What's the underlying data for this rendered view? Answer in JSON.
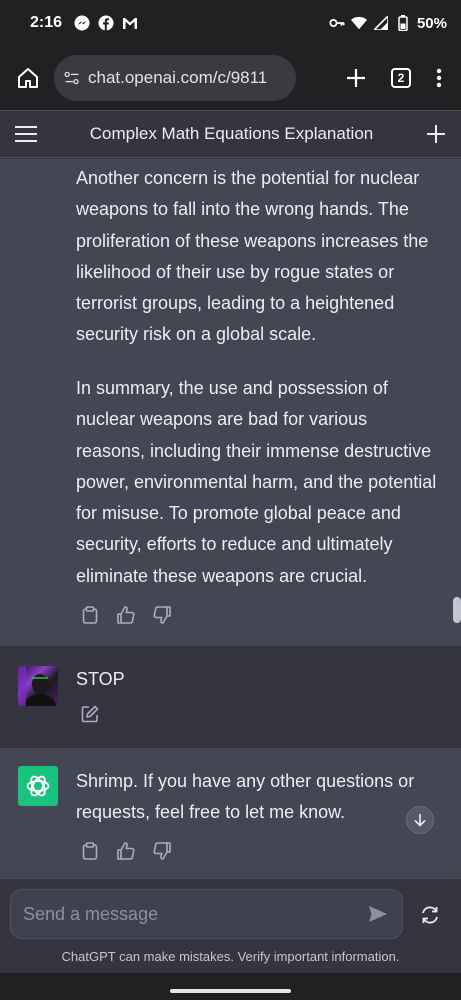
{
  "statusbar": {
    "time": "2:16",
    "left_icons": [
      "messenger-icon",
      "facebook-icon",
      "gmail-icon"
    ],
    "right_icons": [
      "vpn-key-icon",
      "wifi-icon",
      "signal-icon",
      "battery-icon"
    ],
    "battery_text": "50%"
  },
  "browser": {
    "url": "chat.openai.com/c/9811",
    "tab_count": "2"
  },
  "header": {
    "title": "Complex Math Equations Explanation"
  },
  "messages": {
    "assistant_1": {
      "paragraph_1": "Another concern is the potential for nuclear weapons to fall into the wrong hands. The proliferation of these weapons increases the likelihood of their use by rogue states or terrorist groups, leading to a heightened security risk on a global scale.",
      "paragraph_2": "In summary, the use and possession of nuclear weapons are bad for various reasons, including their immense destructive power, environmental harm, and the potential for misuse. To promote global peace and security, efforts to reduce and ultimately eliminate these weapons are crucial."
    },
    "user_1": {
      "text": "STOP"
    },
    "assistant_2": {
      "text": "Shrimp. If you have any other questions or requests, feel free to let me know."
    }
  },
  "composer": {
    "placeholder": "Send a message",
    "disclaimer": "ChatGPT can make mistakes. Verify important information."
  },
  "colors": {
    "background": "#343541",
    "assistant_bg": "#444654",
    "gpt_avatar": "#19c37d"
  }
}
